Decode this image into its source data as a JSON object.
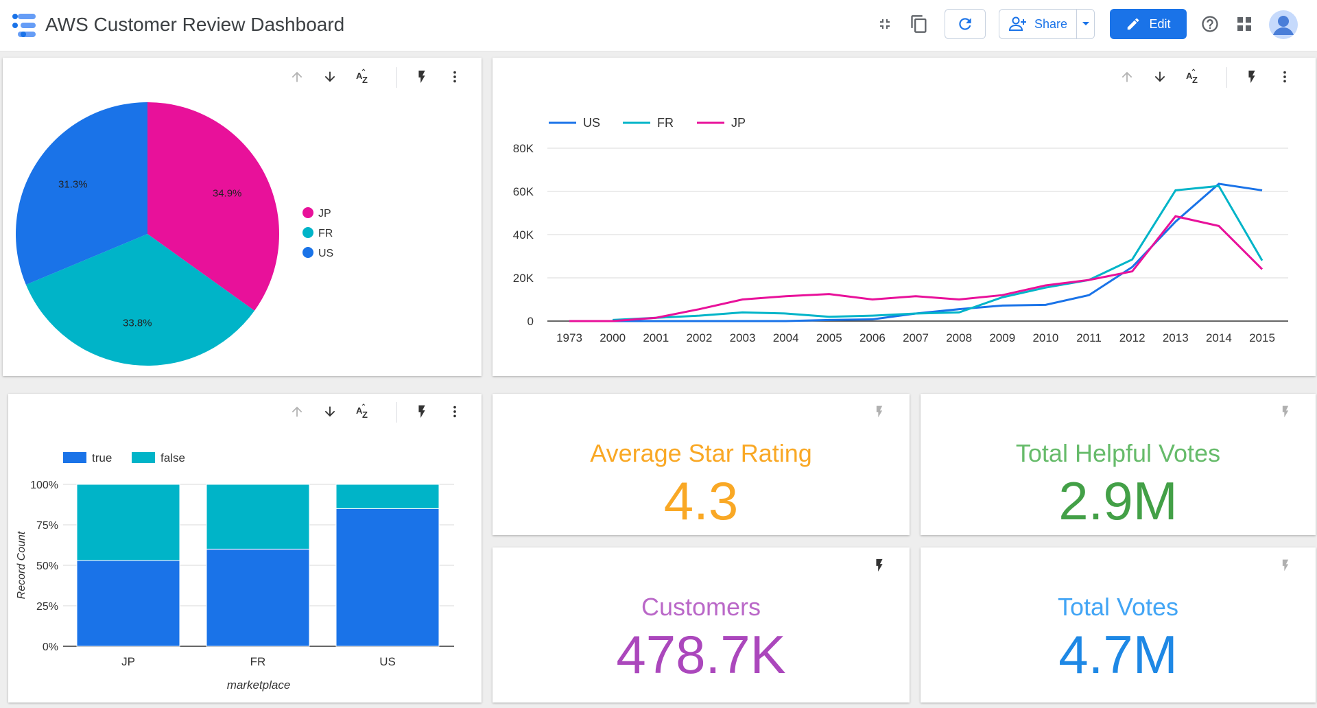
{
  "header": {
    "title": "AWS Customer Review Dashboard",
    "share_label": "Share",
    "edit_label": "Edit"
  },
  "colors": {
    "JP": "#e8119a",
    "FR": "#00b4c8",
    "US": "#1a73e8",
    "true": "#1a73e8",
    "false": "#00b4c8",
    "accent": "#1a73e8"
  },
  "icons": {
    "toolbar": [
      "arrow-up-icon",
      "arrow-down-icon",
      "sort-az-icon",
      "bolt-icon",
      "more-vert-icon"
    ],
    "header": [
      "fullscreen-exit-icon",
      "copy-icon",
      "refresh-icon",
      "add-person-icon",
      "dropdown-icon",
      "pencil-icon",
      "help-icon",
      "apps-grid-icon",
      "account-avatar-icon"
    ]
  },
  "pie_chart": {
    "chart_data": {
      "type": "pie",
      "labels": [
        "JP",
        "FR",
        "US"
      ],
      "values": [
        34.9,
        33.8,
        31.3
      ],
      "value_labels": [
        "34.9%",
        "33.8%",
        "31.3%"
      ],
      "legend": [
        "JP",
        "FR",
        "US"
      ],
      "legend_placement": "right"
    }
  },
  "line_chart": {
    "chart_data": {
      "type": "line",
      "x": [
        "1973",
        "2000",
        "2001",
        "2002",
        "2003",
        "2004",
        "2005",
        "2006",
        "2007",
        "2008",
        "2009",
        "2010",
        "2011",
        "2012",
        "2013",
        "2014",
        "2015"
      ],
      "series": [
        {
          "name": "US",
          "values": [
            null,
            0,
            0,
            0,
            0,
            0,
            500,
            800,
            3500,
            5500,
            7200,
            7500,
            12000,
            25000,
            46000,
            63500,
            60500
          ]
        },
        {
          "name": "FR",
          "values": [
            null,
            500,
            1500,
            2500,
            4000,
            3500,
            2000,
            2500,
            3500,
            4000,
            11000,
            15500,
            19000,
            28500,
            60500,
            62500,
            28000
          ]
        },
        {
          "name": "JP",
          "values": [
            0,
            0,
            1500,
            5500,
            10000,
            11500,
            12500,
            10000,
            11500,
            10000,
            12000,
            16500,
            19000,
            23000,
            48500,
            44000,
            24000
          ]
        }
      ],
      "yticks": [
        "0",
        "20K",
        "40K",
        "60K",
        "80K"
      ],
      "ylim": [
        0,
        80000
      ],
      "legend_placement": "top-left",
      "grid": true
    }
  },
  "bar_chart": {
    "chart_data": {
      "type": "bar",
      "stacked": true,
      "categories": [
        "JP",
        "FR",
        "US"
      ],
      "series": [
        {
          "name": "true",
          "values": [
            53,
            60,
            85
          ]
        },
        {
          "name": "false",
          "values": [
            47,
            40,
            15
          ]
        }
      ],
      "yticks": [
        "0%",
        "25%",
        "50%",
        "75%",
        "100%"
      ],
      "ylim": [
        0,
        100
      ],
      "xlabel": "marketplace",
      "ylabel": "Record Count",
      "legend_placement": "top-left",
      "grid": true
    }
  },
  "scorecards": {
    "avg_rating": {
      "label": "Average Star Rating",
      "value": "4.3",
      "color": "#f9a825"
    },
    "helpful_votes": {
      "label": "Total Helpful Votes",
      "value": "2.9M",
      "color": "#43a047"
    },
    "customers": {
      "label": "Customers",
      "value": "478.7K",
      "color": "#ab47bc"
    },
    "total_votes": {
      "label": "Total Votes",
      "value": "4.7M",
      "color": "#1e88e5"
    }
  }
}
